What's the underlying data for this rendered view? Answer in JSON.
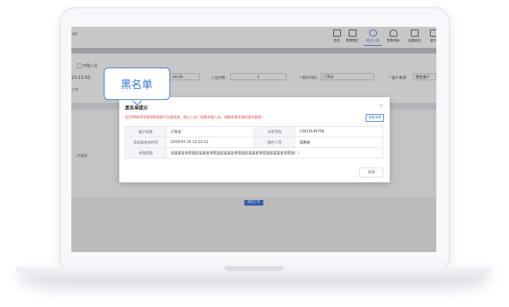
{
  "header": {
    "left_title": "-03",
    "left_sub": "...",
    "nav": [
      {
        "label": "首页",
        "icon": "monitor-icon",
        "active": false
      },
      {
        "label": "客情预订",
        "icon": "edit-icon",
        "active": false
      },
      {
        "label": "登记入住",
        "icon": "check-circle-icon",
        "active": true
      },
      {
        "label": "宾客列表",
        "icon": "user-icon",
        "active": false
      },
      {
        "label": "远期房态",
        "icon": "calendar-icon",
        "active": false
      },
      {
        "label": "统计",
        "icon": "chart-icon",
        "active": false
      }
    ]
  },
  "form": {
    "checkbox_label": "时租入住",
    "time_value": "15:13:52",
    "time_value_2": ":00:00",
    "field_label_1": "价格",
    "adults_label": "入住天数：",
    "adults_value": "1",
    "price_code_label": "* 房价代码：",
    "price_code_value": "门市价",
    "customer_source_label": "* 客户来源：",
    "customer_source_value": "散客客户",
    "list_cell": "户政龙"
  },
  "bottom": {
    "submit_label": "确定订单"
  },
  "modal": {
    "title": "黑名单提示",
    "close": "×",
    "warning": "在CRM系统中查询到该客户为黑名单，禁止入住！如需办理入住，请联系黑名单的录作部等！",
    "detail_button": "查看详情",
    "rows": [
      {
        "k1": "客户名称",
        "v1": "户政龙",
        "k2": "手机号码",
        "v2": "13413145756"
      },
      {
        "k1": "添加黑名单时间",
        "v1": "2019-01-15 12:12:12",
        "k2": "操作人员",
        "v2": "邱惠雨"
      }
    ],
    "reason_label": "添加原因",
    "reason_value": "这是黑名单原因这是黑名单原因这是黑名单原因这是黑名单原因这是黑名单原因！！",
    "ok_button": "关闭"
  },
  "callout": {
    "text": "黑名单"
  }
}
